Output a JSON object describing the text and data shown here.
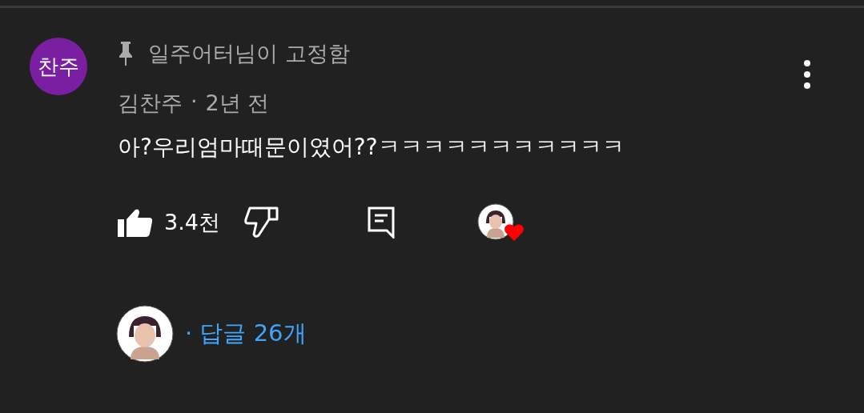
{
  "comment": {
    "author_avatar": {
      "initials": "찬주",
      "color": "#7b1fa2"
    },
    "pinned": {
      "on": true,
      "text": "일주어터님이 고정함"
    },
    "author": "김찬주",
    "separator": "·",
    "time": "2년 전",
    "text": "아?우리엄마때문이였어??ㅋㅋㅋㅋㅋㅋㅋㅋㅋㅋㅋ",
    "likes": "3.4천",
    "creator_hearted": true,
    "replies": {
      "text": "· 답글 26개"
    }
  }
}
